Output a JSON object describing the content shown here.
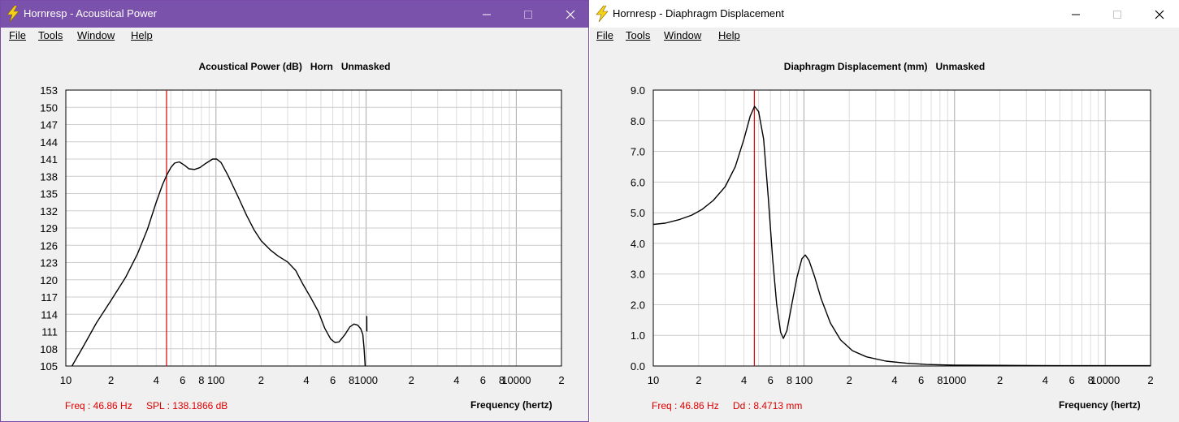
{
  "windows": [
    {
      "id": "win1",
      "title": "Hornresp - Acoustical Power",
      "menu": [
        "File",
        "Tools",
        "Window",
        "Help"
      ],
      "chart_title": "Acoustical Power (dB)   Horn   Unmasked",
      "status": {
        "freq": "Freq : 46.86 Hz",
        "value": "SPL : 138.1866 dB"
      },
      "xaxis_label": "Frequency (hertz)",
      "chart_data": {
        "type": "line",
        "title": "Acoustical Power (dB)   Horn   Unmasked",
        "xlabel": "Frequency (hertz)",
        "ylabel": "",
        "x_scale": "log",
        "xlim": [
          10,
          20000
        ],
        "ylim": [
          105,
          153
        ],
        "grid": true,
        "x_ticks": [
          {
            "value": 10,
            "label": "10"
          },
          {
            "value": 20,
            "label": "2"
          },
          {
            "value": 40,
            "label": "4"
          },
          {
            "value": 60,
            "label": "6"
          },
          {
            "value": 80,
            "label": "8"
          },
          {
            "value": 100,
            "label": "100"
          },
          {
            "value": 200,
            "label": "2"
          },
          {
            "value": 400,
            "label": "4"
          },
          {
            "value": 600,
            "label": "6"
          },
          {
            "value": 800,
            "label": "8"
          },
          {
            "value": 1000,
            "label": "1000"
          },
          {
            "value": 2000,
            "label": "2"
          },
          {
            "value": 4000,
            "label": "4"
          },
          {
            "value": 6000,
            "label": "6"
          },
          {
            "value": 8000,
            "label": "8"
          },
          {
            "value": 10000,
            "label": "10000"
          },
          {
            "value": 20000,
            "label": "2"
          }
        ],
        "y_ticks": [
          "153",
          "150",
          "147",
          "144",
          "141",
          "138",
          "135",
          "132",
          "129",
          "126",
          "123",
          "120",
          "117",
          "114",
          "111",
          "108",
          "105"
        ],
        "marker": {
          "x": 46.86,
          "color": "#e00000"
        },
        "series": [
          {
            "color": "#000000",
            "points": [
              [
                11,
                105
              ],
              [
                13,
                108.3
              ],
              [
                16,
                112.5
              ],
              [
                20,
                116.4
              ],
              [
                25,
                120.4
              ],
              [
                30,
                124.5
              ],
              [
                35,
                128.8
              ],
              [
                40,
                133.5
              ],
              [
                44,
                136.5
              ],
              [
                47,
                138.2
              ],
              [
                50,
                139.5
              ],
              [
                53,
                140.3
              ],
              [
                57,
                140.5
              ],
              [
                62,
                139.9
              ],
              [
                66,
                139.3
              ],
              [
                72,
                139.2
              ],
              [
                78,
                139.5
              ],
              [
                85,
                140.2
              ],
              [
                95,
                141
              ],
              [
                101,
                141
              ],
              [
                108,
                140.4
              ],
              [
                120,
                138.2
              ],
              [
                140,
                134.5
              ],
              [
                160,
                131.2
              ],
              [
                180,
                128.6
              ],
              [
                200,
                126.8
              ],
              [
                230,
                125.2
              ],
              [
                260,
                124.1
              ],
              [
                300,
                123.1
              ],
              [
                340,
                121.6
              ],
              [
                380,
                119.2
              ],
              [
                430,
                116.8
              ],
              [
                480,
                114.5
              ],
              [
                530,
                111.6
              ],
              [
                580,
                109.7
              ],
              [
                620,
                109.1
              ],
              [
                660,
                109.2
              ],
              [
                720,
                110.4
              ],
              [
                780,
                111.8
              ],
              [
                830,
                112.3
              ],
              [
                880,
                112.1
              ],
              [
                920,
                111.5
              ],
              [
                950,
                110.5
              ],
              [
                970,
                108
              ],
              [
                985,
                105
              ]
            ]
          },
          {
            "color": "#000000",
            "points": [
              [
                1010,
                113.7
              ],
              [
                1012,
                111.0
              ]
            ]
          }
        ]
      }
    },
    {
      "id": "win2",
      "title": "Hornresp - Diaphragm Displacement",
      "menu": [
        "File",
        "Tools",
        "Window",
        "Help"
      ],
      "chart_title": "Diaphragm Displacement (mm)   Unmasked",
      "status": {
        "freq": "Freq : 46.86 Hz",
        "value": "Dd : 8.4713 mm"
      },
      "xaxis_label": "Frequency (hertz)",
      "chart_data": {
        "type": "line",
        "title": "Diaphragm Displacement (mm)   Unmasked",
        "xlabel": "Frequency (hertz)",
        "ylabel": "",
        "x_scale": "log",
        "xlim": [
          10,
          20000
        ],
        "ylim": [
          0,
          9
        ],
        "grid": true,
        "x_ticks": [
          {
            "value": 10,
            "label": "10"
          },
          {
            "value": 20,
            "label": "2"
          },
          {
            "value": 40,
            "label": "4"
          },
          {
            "value": 60,
            "label": "6"
          },
          {
            "value": 80,
            "label": "8"
          },
          {
            "value": 100,
            "label": "100"
          },
          {
            "value": 200,
            "label": "2"
          },
          {
            "value": 400,
            "label": "4"
          },
          {
            "value": 600,
            "label": "6"
          },
          {
            "value": 800,
            "label": "8"
          },
          {
            "value": 1000,
            "label": "1000"
          },
          {
            "value": 2000,
            "label": "2"
          },
          {
            "value": 4000,
            "label": "4"
          },
          {
            "value": 6000,
            "label": "6"
          },
          {
            "value": 8000,
            "label": "8"
          },
          {
            "value": 10000,
            "label": "10000"
          },
          {
            "value": 20000,
            "label": "2"
          }
        ],
        "y_ticks": [
          "9.0",
          "8.0",
          "7.0",
          "6.0",
          "5.0",
          "4.0",
          "3.0",
          "2.0",
          "1.0",
          "0.0"
        ],
        "marker": {
          "x": 46.86,
          "color": "#e00000"
        },
        "series": [
          {
            "color": "#000000",
            "points": [
              [
                10,
                4.62
              ],
              [
                12,
                4.66
              ],
              [
                15,
                4.78
              ],
              [
                18,
                4.92
              ],
              [
                21,
                5.1
              ],
              [
                25,
                5.4
              ],
              [
                30,
                5.85
              ],
              [
                35,
                6.5
              ],
              [
                40,
                7.4
              ],
              [
                44,
                8.15
              ],
              [
                47,
                8.47
              ],
              [
                50,
                8.3
              ],
              [
                54,
                7.4
              ],
              [
                58,
                5.5
              ],
              [
                62,
                3.5
              ],
              [
                66,
                2.0
              ],
              [
                70,
                1.1
              ],
              [
                73,
                0.9
              ],
              [
                77,
                1.15
              ],
              [
                83,
                2.0
              ],
              [
                90,
                2.9
              ],
              [
                97,
                3.5
              ],
              [
                102,
                3.62
              ],
              [
                108,
                3.45
              ],
              [
                118,
                2.9
              ],
              [
                130,
                2.2
              ],
              [
                150,
                1.4
              ],
              [
                175,
                0.85
              ],
              [
                210,
                0.5
              ],
              [
                260,
                0.3
              ],
              [
                350,
                0.16
              ],
              [
                480,
                0.09
              ],
              [
                650,
                0.05
              ],
              [
                1000,
                0.03
              ],
              [
                2000,
                0.02
              ],
              [
                5000,
                0.01
              ],
              [
                20000,
                0.01
              ]
            ]
          }
        ]
      }
    }
  ]
}
